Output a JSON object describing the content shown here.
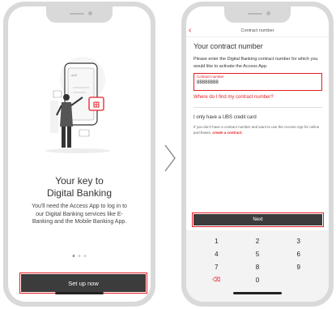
{
  "left_screen": {
    "headline_line1": "Your key to",
    "headline_line2": "Digital Banking",
    "body_line1": "You'll need the Access App to log in to",
    "body_line2": "our Digital Banking services like E-",
    "body_line3": "Banking and the Mobile Banking App.",
    "pagination": {
      "total": 3,
      "active": 1
    },
    "setup_button": "Set up now"
  },
  "right_screen": {
    "nav_title": "Contract number",
    "back_icon": "chevron-left-icon",
    "title": "Your contract number",
    "description": "Please enter the Digital Banking contract number for which you would like to activate the Access App.",
    "field": {
      "label": "Contract number",
      "value": "88888888"
    },
    "help_link": "Where do I find my contract number?",
    "card_title": "I only have a UBS credit card",
    "card_desc": "If you don't have a contract number and want to use the Access App for online purchases,",
    "card_link": "create a contract.",
    "next_button": "Next",
    "keypad": [
      "1",
      "2",
      "3",
      "4",
      "5",
      "6",
      "7",
      "8",
      "9",
      "",
      "0",
      ""
    ],
    "delete_key_icon": "backspace-icon"
  },
  "colors": {
    "accent": "#e31e24",
    "button": "#3c3c3c",
    "frame": "#d9d9d9"
  }
}
